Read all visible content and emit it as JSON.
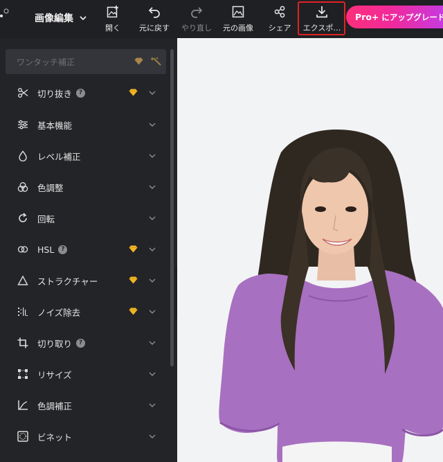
{
  "toolbar": {
    "mode_label": "画像編集",
    "open": "開く",
    "undo": "元に戻す",
    "redo": "やり直し",
    "original": "元の画像",
    "share": "シェア",
    "export": "エクスポ…",
    "pro_prefix": "Pro+",
    "pro_label": "にアップグレードする"
  },
  "panel": {
    "autofix": "ワンタッチ補正",
    "items": [
      {
        "label": "切り抜き",
        "icon": "scissors-icon",
        "help": "?",
        "premium": true
      },
      {
        "label": "基本機能",
        "icon": "sliders-icon",
        "premium": false
      },
      {
        "label": "レベル補正",
        "icon": "droplet-icon",
        "premium": false
      },
      {
        "label": "色調整",
        "icon": "color-circles-icon",
        "premium": false
      },
      {
        "label": "回転",
        "icon": "rotate-icon",
        "premium": false
      },
      {
        "label": "HSL",
        "icon": "hsl-icon",
        "help": "?",
        "premium": true
      },
      {
        "label": "ストラクチャー",
        "icon": "triangle-icon",
        "premium": true
      },
      {
        "label": "ノイズ除去",
        "icon": "noise-icon",
        "premium": true
      },
      {
        "label": "切り取り",
        "icon": "crop-icon",
        "help": "?",
        "premium": false
      },
      {
        "label": "リサイズ",
        "icon": "resize-icon",
        "premium": false
      },
      {
        "label": "色調補正",
        "icon": "curve-icon",
        "premium": false
      },
      {
        "label": "ビネット",
        "icon": "vignette-icon",
        "premium": false
      }
    ]
  },
  "colors": {
    "premium_gem": "#f2b526",
    "highlight_border": "#e02424",
    "pro_gradient_start": "#ff2f7a",
    "pro_gradient_end": "#c23ce8"
  }
}
